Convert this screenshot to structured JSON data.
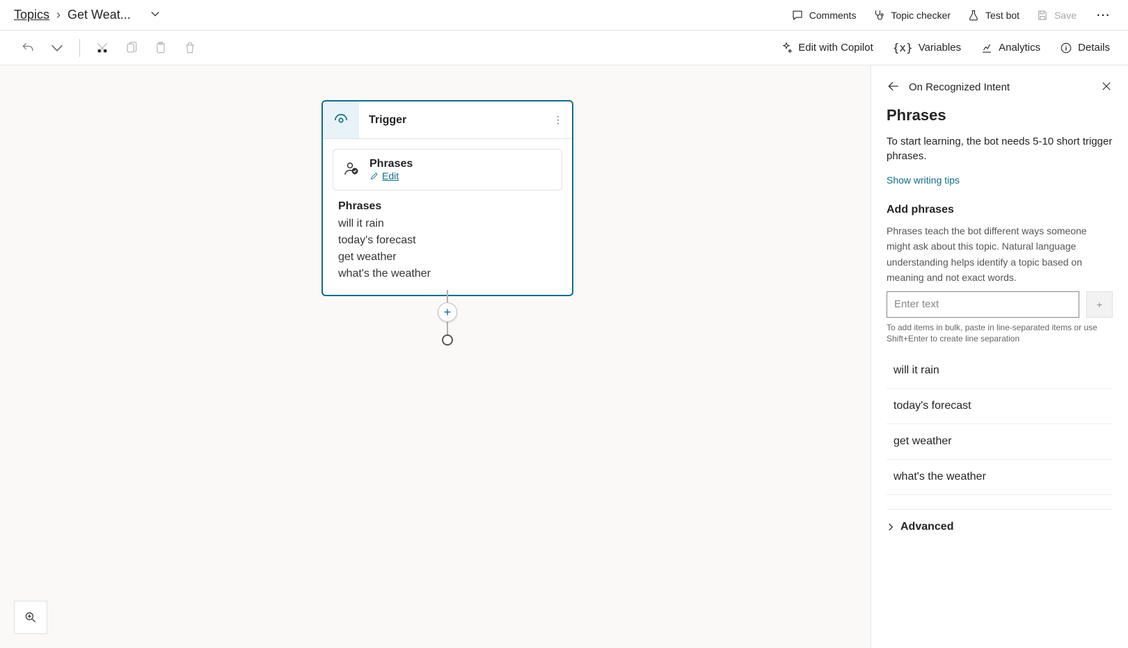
{
  "breadcrumb": {
    "root": "Topics",
    "current": "Get Weat..."
  },
  "topbar": {
    "comments": "Comments",
    "topic_checker": "Topic checker",
    "test_bot": "Test bot",
    "save": "Save"
  },
  "secondbar": {
    "edit_copilot": "Edit with Copilot",
    "variables": "Variables",
    "analytics": "Analytics",
    "details": "Details"
  },
  "node": {
    "title": "Trigger",
    "card_label": "Phrases",
    "edit": "Edit",
    "list_heading": "Phrases",
    "phrases": [
      "will it rain",
      "today's forecast",
      "get weather",
      "what's the weather"
    ]
  },
  "panel": {
    "breadcrumb_title": "On Recognized Intent",
    "heading": "Phrases",
    "lead": "To start learning, the bot needs 5-10 short trigger phrases.",
    "tips_link": "Show writing tips",
    "add_heading": "Add phrases",
    "add_desc": "Phrases teach the bot different ways someone might ask about this topic. Natural language understanding helps identify a topic based on meaning and not exact words.",
    "input_placeholder": "Enter text",
    "bulk_hint": "To add items in bulk, paste in line-separated items or use Shift+Enter to create line separation",
    "phrases": [
      "will it rain",
      "today's forecast",
      "get weather",
      "what's the weather"
    ],
    "advanced": "Advanced"
  }
}
